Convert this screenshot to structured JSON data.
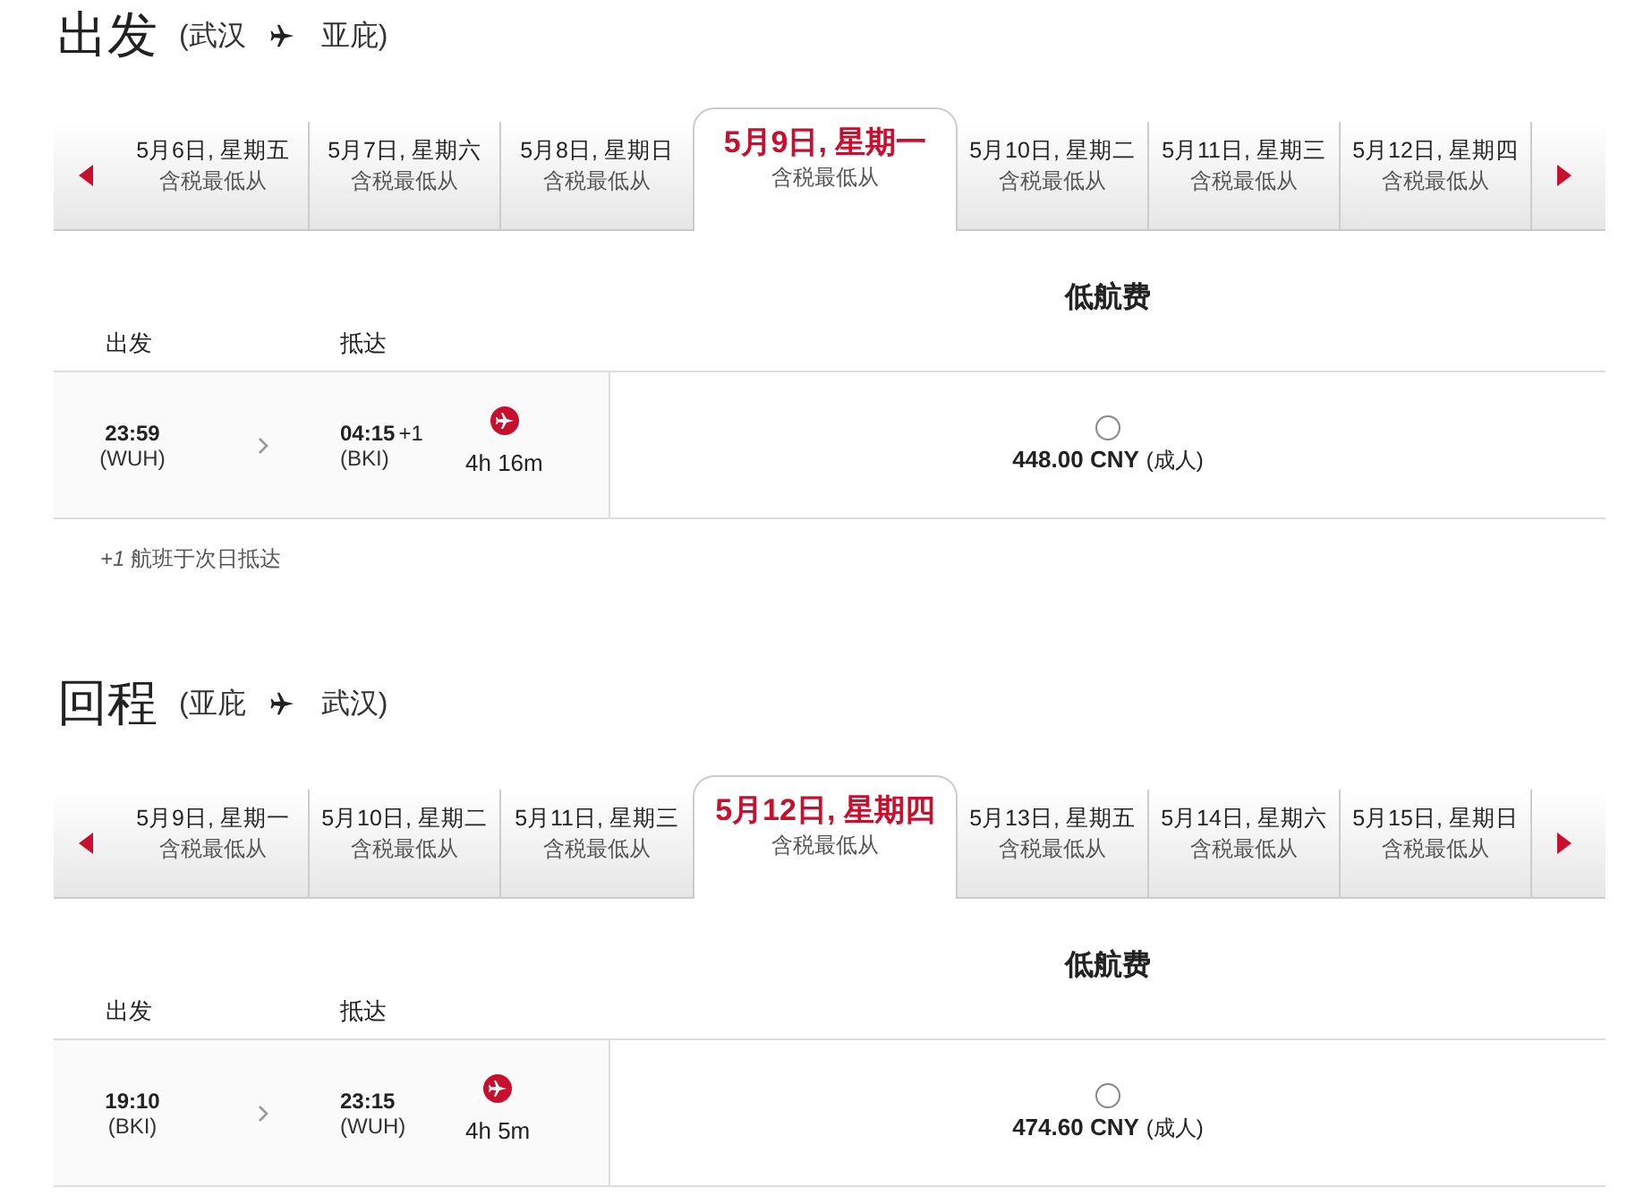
{
  "sections": [
    {
      "title": "出发",
      "from": "(武汉",
      "to": "亚庇)",
      "dates": [
        {
          "date": "5月6日, 星期五",
          "sub": "含税最低从",
          "selected": false
        },
        {
          "date": "5月7日, 星期六",
          "sub": "含税最低从",
          "selected": false
        },
        {
          "date": "5月8日, 星期日",
          "sub": "含税最低从",
          "selected": false
        },
        {
          "date": "5月9日, 星期一",
          "sub": "含税最低从",
          "selected": true
        },
        {
          "date": "5月10日, 星期二",
          "sub": "含税最低从",
          "selected": false
        },
        {
          "date": "5月11日, 星期三",
          "sub": "含税最低从",
          "selected": false
        },
        {
          "date": "5月12日, 星期四",
          "sub": "含税最低从",
          "selected": false
        }
      ],
      "fare_header": "低航费",
      "col_depart": "出发",
      "col_arrive": "抵达",
      "flights": [
        {
          "dep_time": "23:59",
          "dep_code": "(WUH)",
          "arr_time": "04:15",
          "next_day": "+1",
          "arr_code": "(BKI)",
          "duration": "4h 16m",
          "price": "448.00 CNY",
          "pax": "(成人)",
          "selected": false
        }
      ],
      "note": "*+1* 航班于次日抵达"
    },
    {
      "title": "回程",
      "from": "(亚庇",
      "to": "武汉)",
      "dates": [
        {
          "date": "5月9日, 星期一",
          "sub": "含税最低从",
          "selected": false
        },
        {
          "date": "5月10日, 星期二",
          "sub": "含税最低从",
          "selected": false
        },
        {
          "date": "5月11日, 星期三",
          "sub": "含税最低从",
          "selected": false
        },
        {
          "date": "5月12日, 星期四",
          "sub": "含税最低从",
          "selected": true
        },
        {
          "date": "5月13日, 星期五",
          "sub": "含税最低从",
          "selected": false
        },
        {
          "date": "5月14日, 星期六",
          "sub": "含税最低从",
          "selected": false
        },
        {
          "date": "5月15日, 星期日",
          "sub": "含税最低从",
          "selected": false
        }
      ],
      "fare_header": "低航费",
      "col_depart": "出发",
      "col_arrive": "抵达",
      "flights": [
        {
          "dep_time": "19:10",
          "dep_code": "(BKI)",
          "arr_time": "23:15",
          "arr_code": "(WUH)",
          "duration": "4h 5m",
          "price": "474.60 CNY",
          "pax": "(成人)",
          "selected": false
        }
      ]
    }
  ]
}
